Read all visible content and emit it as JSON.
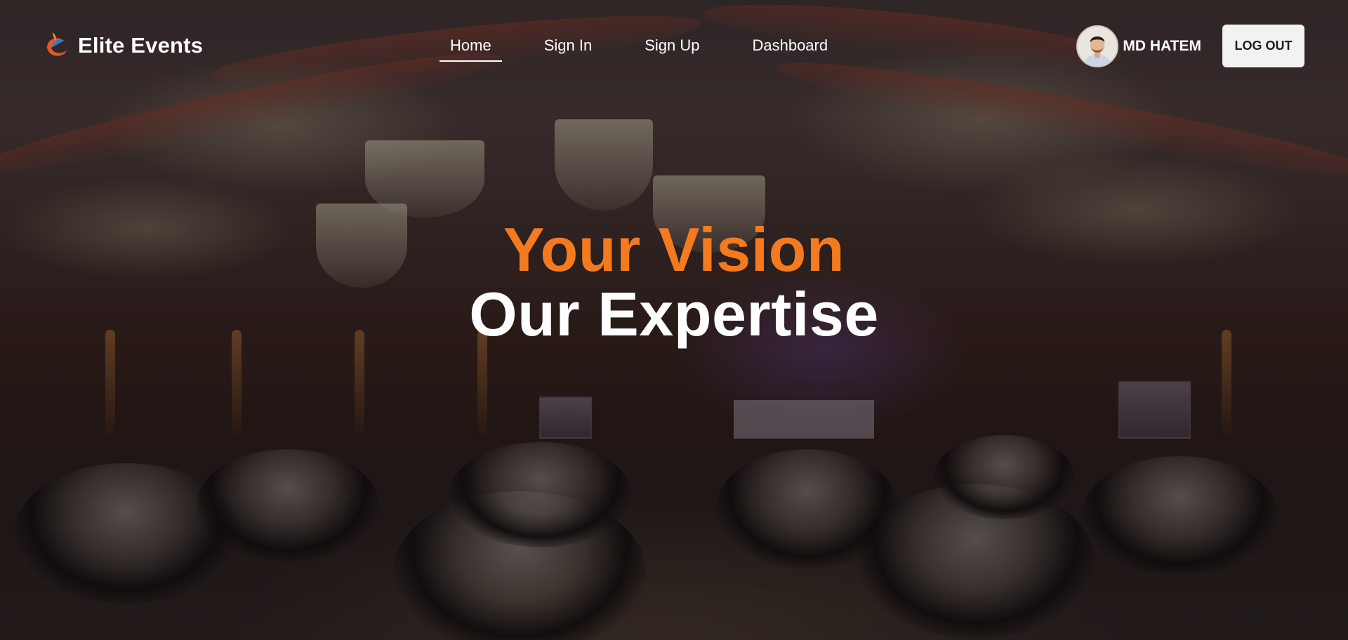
{
  "brand": {
    "name": "Elite Events",
    "logo_icon": "elite-events-logo-icon",
    "logo_colors": [
      "#2a7bd6",
      "#e8542a",
      "#f39a2a"
    ]
  },
  "nav": {
    "items": [
      {
        "label": "Home",
        "active": true
      },
      {
        "label": "Sign In",
        "active": false
      },
      {
        "label": "Sign Up",
        "active": false
      },
      {
        "label": "Dashboard",
        "active": false
      }
    ]
  },
  "user": {
    "name": "MD HATEM",
    "avatar_icon": "user-avatar"
  },
  "actions": {
    "logout_label": "LOG OUT"
  },
  "hero": {
    "line1": "Your Vision",
    "line2": "Our Expertise",
    "accent_color": "#f47a20",
    "text_color": "#ffffff",
    "background": "banquet-hall-photo"
  }
}
